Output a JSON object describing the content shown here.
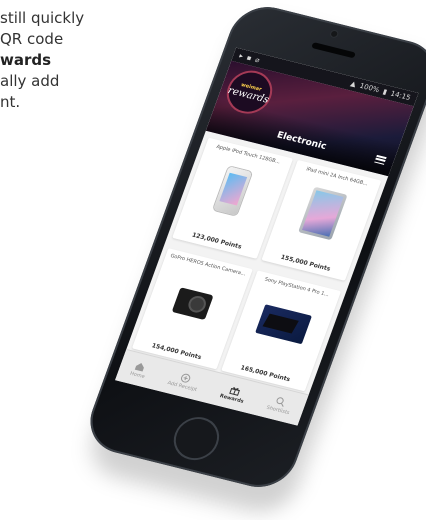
{
  "promo": {
    "lines": [
      "still quickly",
      "QR code",
      "wards",
      "ally add",
      "nt."
    ]
  },
  "status_bar": {
    "left_icons": [
      "▸",
      "▪",
      "⌀"
    ],
    "battery": "100%",
    "time": "14:15"
  },
  "header": {
    "logo_top": "weimar",
    "logo_main": "rewards",
    "title": "Electronic",
    "menu_icon": "menu-icon"
  },
  "products": [
    {
      "title": "Apple iPod Touch 128GB...",
      "points": "123,000 Points",
      "image": "ipod-image"
    },
    {
      "title": "iPad mini 2A Inch 64GB...",
      "points": "155,000 Points",
      "image": "ipad-image"
    },
    {
      "title": "GoPro HERO5 Action Camera...",
      "points": "154,000 Points",
      "image": "gopro-image"
    },
    {
      "title": "Sony PlayStation 4 Pro 1...",
      "points": "165,000 Points",
      "image": "ps4-image"
    }
  ],
  "nav": [
    {
      "label": "Home",
      "icon": "home-icon",
      "active": false
    },
    {
      "label": "Add Receipt",
      "icon": "add-receipt-icon",
      "active": false
    },
    {
      "label": "Rewards",
      "icon": "gift-icon",
      "active": true
    },
    {
      "label": "Shortlists",
      "icon": "search-icon",
      "active": false
    }
  ],
  "colors": {
    "accent": "#a43a56",
    "header_bg": "#2b0f2e",
    "screen_bg": "#f3f3f3"
  }
}
